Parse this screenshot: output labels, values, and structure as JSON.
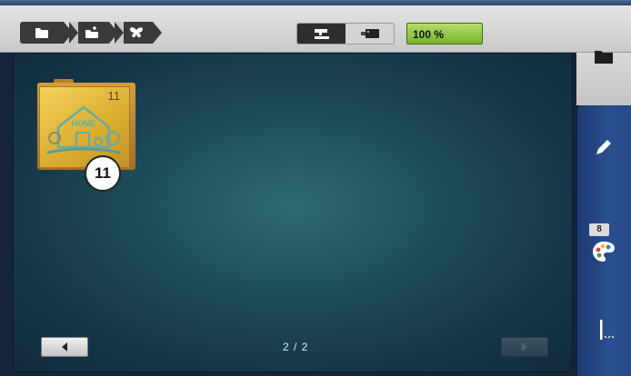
{
  "toolbar": {
    "breadcrumbs": [
      {
        "icon": "folder-icon"
      },
      {
        "icon": "folder-add-icon"
      },
      {
        "icon": "butterfly-icon"
      }
    ],
    "view_modes": [
      {
        "icon": "sewing-machine-icon",
        "active": true
      },
      {
        "icon": "embroidery-module-icon",
        "active": false
      }
    ],
    "zoom_label": "100 %"
  },
  "folder": {
    "count": "11",
    "badge": "11",
    "thumbnail_text": "HOME"
  },
  "pager": {
    "indicator": "2 / 2"
  },
  "sidebar": {
    "top_icon": "folder-icon",
    "items": [
      {
        "icon": "pencil-icon"
      },
      {
        "icon": "color-palette-icon",
        "badge": "8"
      },
      {
        "icon": "needle-icon"
      }
    ]
  },
  "colors": {
    "zoom_green": "#8cc63f",
    "toolbar_dark": "#3a3a3a",
    "sidebar_blue": "#2b4f8f",
    "folder_gold": "#e2b43f"
  }
}
